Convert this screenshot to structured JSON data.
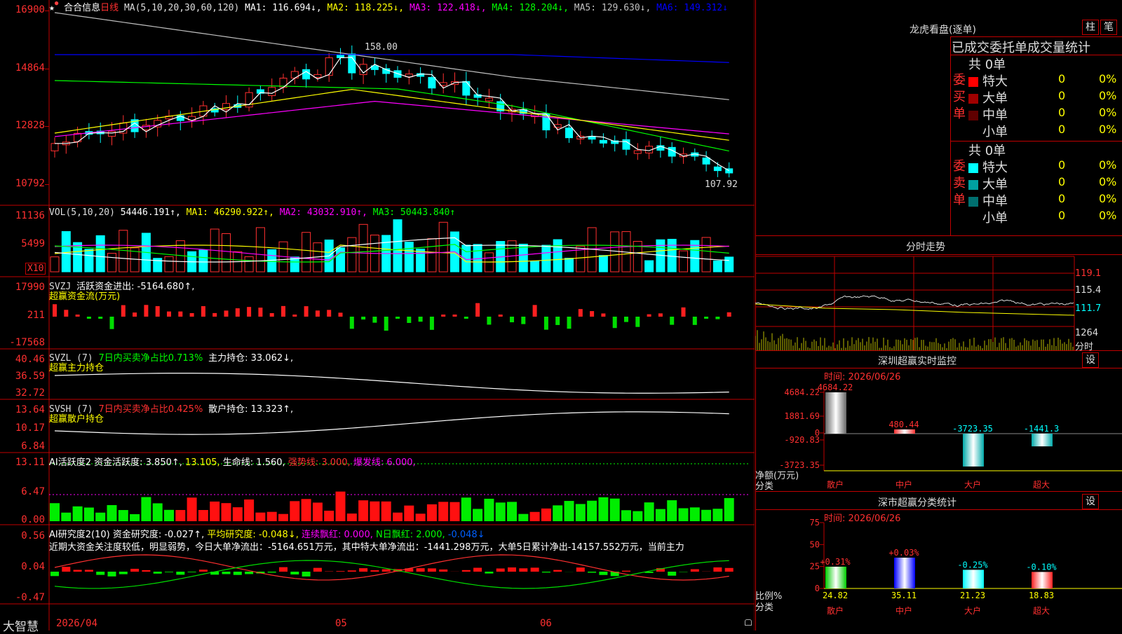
{
  "main_chart": {
    "stock_name": "合合信息",
    "period": "日线",
    "ma_title": "MA(5,10,20,30,60,120)",
    "ma_values": [
      {
        "label": "MA1:",
        "value": "116.694↓,",
        "color": "#ffffff"
      },
      {
        "label": "MA2:",
        "value": "118.225↓,",
        "color": "#ffff00"
      },
      {
        "label": "MA3:",
        "value": "122.418↓,",
        "color": "#ff00ff"
      },
      {
        "label": "MA4:",
        "value": "128.204↓,",
        "color": "#00ff00"
      },
      {
        "label": "MA5:",
        "value": "129.630↓,",
        "color": "#c0c0c0"
      },
      {
        "label": "MA6:",
        "value": "149.312↓",
        "color": "#0000ff"
      }
    ],
    "y_labels": [
      "16900",
      "14864",
      "12828",
      "10792"
    ],
    "high_label": "158.00",
    "low_label": "107.92"
  },
  "vol_chart": {
    "title": "VOL(5,10,20)",
    "value": "54446.191↑,",
    "ma1": "MA1: 46290.922↑,",
    "ma2": "MA2: 43032.910↑,",
    "ma3": "MA3: 50443.840↑",
    "y_labels": [
      "11136",
      "5499"
    ],
    "unit": "X10"
  },
  "svzj": {
    "title": "SVZJ",
    "label": "活跃资金进出: -5164.680↑,",
    "sub": "超赢资金流(万元)",
    "y_labels": [
      "17990",
      "211",
      "-17568"
    ]
  },
  "svzl": {
    "title": "SVZL (7)",
    "label1": "7日内买卖净占比0.713%",
    "label2": "主力持仓: 33.062↓,",
    "sub": "超赢主力持仓",
    "y_labels": [
      "40.46",
      "36.59",
      "32.72"
    ]
  },
  "svsh": {
    "title": "SVSH (7)",
    "label1": "7日内买卖净占比0.425%",
    "label2": "散户持仓: 13.323↑,",
    "sub": "超赢散户持仓",
    "y_labels": [
      "13.64",
      "10.17",
      "6.84"
    ]
  },
  "ai_activity": {
    "title": "AI活跃度2 资金活跃度: 3.850↑,",
    "v2": "13.105,",
    "v3": "生命线: 1.560,",
    "v4": "强势线: 3.000,",
    "v5": "爆发线: 6.000,",
    "y_labels": [
      "13.11",
      "6.47",
      "0.00"
    ]
  },
  "ai_research": {
    "title": "AI研究度2(10) 资金研究度: -0.027↑,",
    "avg": "平均研究度: -0.048↓,",
    "red1": "连续飘红: 0.000,",
    "red2": "N日飘红: 2.000,",
    "v": "-0.048↓",
    "text": "近期大资金关注度较低，明显弱势，今日大单净流出：-5164.651万元，其中特大单净流出：-1441.298万元，大单5日累计净出-14157.552万元，当前主力",
    "y_labels": [
      "0.56",
      "0.04",
      "-0.47"
    ]
  },
  "bottom": {
    "brand": "大智慧",
    "dates": [
      "2026/04",
      "05",
      "06"
    ]
  },
  "dragon_tiger": {
    "title": "龙虎看盘(逐单)",
    "btn1": "柱",
    "btn2": "笔",
    "subtitle": "已成交委托单成交量统计",
    "buy": {
      "side_label": "委买单",
      "total": "共 0单",
      "rows": [
        {
          "name": "特大",
          "count": "0",
          "pct": "0%",
          "color": "#ff0000"
        },
        {
          "name": "大单",
          "count": "0",
          "pct": "0%",
          "color": "#a00000"
        },
        {
          "name": "中单",
          "count": "0",
          "pct": "0%",
          "color": "#600000"
        },
        {
          "name": "小单",
          "count": "0",
          "pct": "0%",
          "color": "#000000"
        }
      ]
    },
    "sell": {
      "side_label": "委卖单",
      "total": "共 0单",
      "rows": [
        {
          "name": "特大",
          "count": "0",
          "pct": "0%",
          "color": "#00ffff"
        },
        {
          "name": "大单",
          "count": "0",
          "pct": "0%",
          "color": "#00a0a0"
        },
        {
          "name": "中单",
          "count": "0",
          "pct": "0%",
          "color": "#007070"
        },
        {
          "name": "小单",
          "count": "0",
          "pct": "0%",
          "color": "#000000"
        }
      ]
    }
  },
  "intraday": {
    "title": "分时走势",
    "right_labels": [
      "119.1",
      "115.4",
      "111.7",
      "1264"
    ],
    "time_label": "分时"
  },
  "sz_monitor": {
    "title": "深圳超赢实时监控",
    "btn": "设",
    "time": "时间: 2026/06/26",
    "y_labels": [
      "4684.22",
      "1881.69",
      "0",
      "-920.83",
      "-3723.35"
    ],
    "axis_label1": "净额(万元)",
    "axis_label2": "分类",
    "bars": [
      {
        "cat": "散户",
        "value": "4684.22"
      },
      {
        "cat": "中户",
        "value": "480.44"
      },
      {
        "cat": "大户",
        "value": "-3723.35"
      },
      {
        "cat": "超大",
        "value": "-1441.3"
      }
    ]
  },
  "sz_category": {
    "title": "深市超赢分类统计",
    "btn": "设",
    "time": "时间: 2026/06/26",
    "y_labels": [
      "75",
      "50",
      "25",
      "0"
    ],
    "axis_label1": "比例%",
    "axis_label2": "分类",
    "bars": [
      {
        "cat": "散户",
        "change": "+0.31%",
        "value": "24.82"
      },
      {
        "cat": "中户",
        "change": "+0.03%",
        "value": "35.11"
      },
      {
        "cat": "大户",
        "change": "-0.25%",
        "value": "21.23"
      },
      {
        "cat": "超大",
        "change": "-0.10%",
        "value": "18.83"
      }
    ]
  }
}
